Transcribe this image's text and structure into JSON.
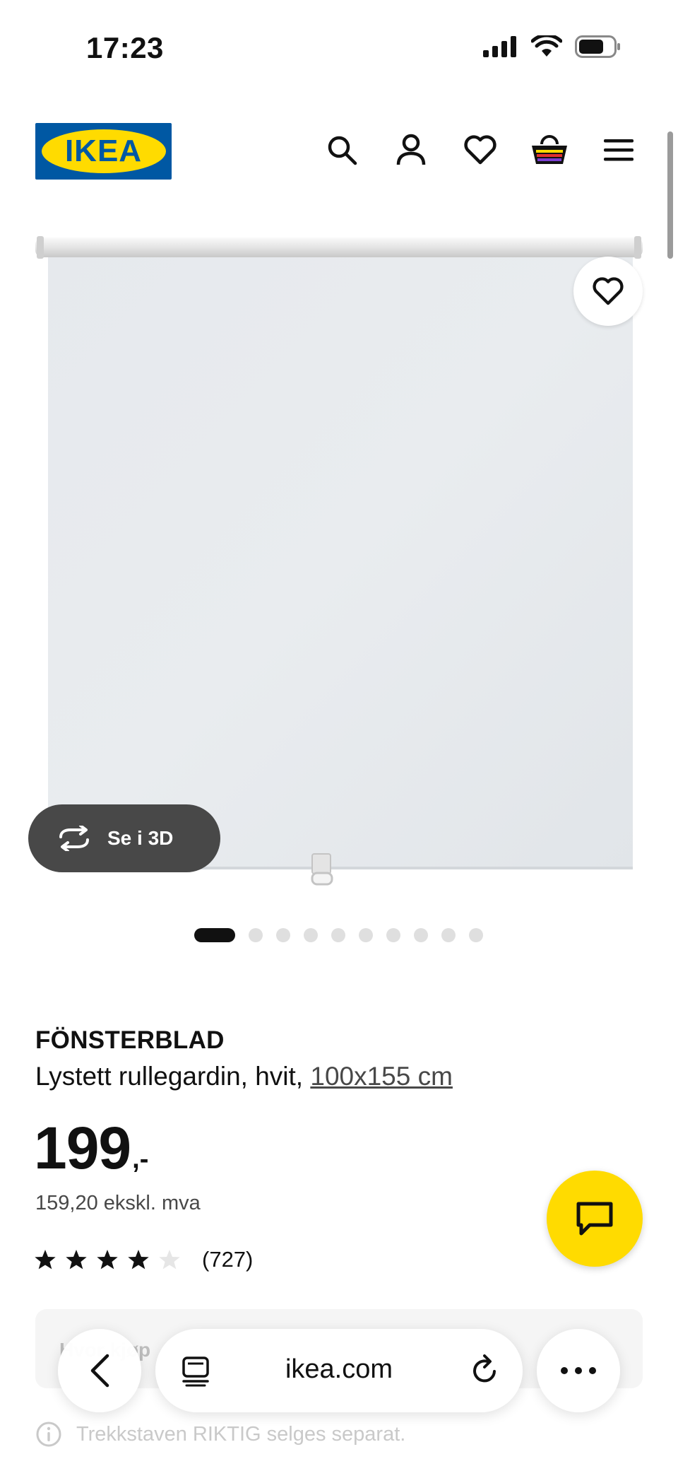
{
  "status_bar": {
    "time": "17:23",
    "icons": [
      "signal-icon",
      "wifi-icon",
      "battery-icon"
    ]
  },
  "header": {
    "logo_text": "IKEA",
    "icons": [
      "search-icon",
      "account-icon",
      "heart-icon",
      "basket-icon",
      "menu-icon"
    ]
  },
  "product": {
    "image_alt": "FÖNSTERBLAD roller blind",
    "see_3d_label": "Se i 3D",
    "carousel": {
      "count": 11,
      "active_index": 0
    },
    "name": "FÖNSTERBLAD",
    "description": "Lystett rullegardin, hvit, ",
    "size": "100x155 cm",
    "price": "199",
    "price_suffix": ",-",
    "price_excl_vat": "159,20 ekskl. mva",
    "rating": {
      "value": 4,
      "max": 5,
      "count": "(727)"
    }
  },
  "section": {
    "partial_label": "Hvor kjøp"
  },
  "info": {
    "text": "Trekkstaven RIKTIG selges separat."
  },
  "browser_toolbar": {
    "url": "ikea.com"
  },
  "colors": {
    "ikea_blue": "#0058a3",
    "ikea_yellow": "#ffdb00",
    "text": "#111111",
    "button_dark": "#484848"
  }
}
